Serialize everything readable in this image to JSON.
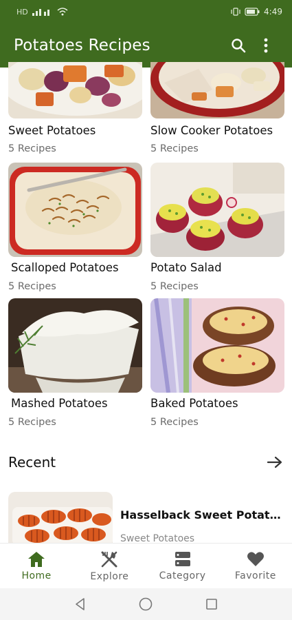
{
  "status_bar": {
    "left_text": "HD",
    "time": "4:49"
  },
  "app_bar": {
    "title": "Potatoes Recipes",
    "search_icon": "search-icon",
    "menu_icon": "more-vert-icon"
  },
  "categories": [
    {
      "title": "Sweet Potatoes",
      "count": "5 Recipes"
    },
    {
      "title": "Slow Cooker Potatoes",
      "count": "5 Recipes"
    },
    {
      "title": "Scalloped Potatoes",
      "count": "5 Recipes"
    },
    {
      "title": "Potato Salad",
      "count": "5 Recipes"
    },
    {
      "title": "Mashed Potatoes",
      "count": "5 Recipes"
    },
    {
      "title": "Baked Potatoes",
      "count": "5 Recipes"
    }
  ],
  "recent": {
    "title": "Recent",
    "arrow_icon": "arrow-right-icon",
    "items": [
      {
        "name": "Hasselback Sweet Potato ...",
        "category": "Sweet Potatoes"
      }
    ]
  },
  "bottom_nav": {
    "items": [
      {
        "label": "Home",
        "icon": "home-icon",
        "active": true
      },
      {
        "label": "Explore",
        "icon": "fork-knife-icon",
        "active": false
      },
      {
        "label": "Category",
        "icon": "category-icon",
        "active": false
      },
      {
        "label": "Favorite",
        "icon": "heart-icon",
        "active": false
      }
    ]
  },
  "colors": {
    "primary": "#3f6b1f",
    "active_nav": "#3f6b1f",
    "muted_text": "#6b6b6b"
  }
}
